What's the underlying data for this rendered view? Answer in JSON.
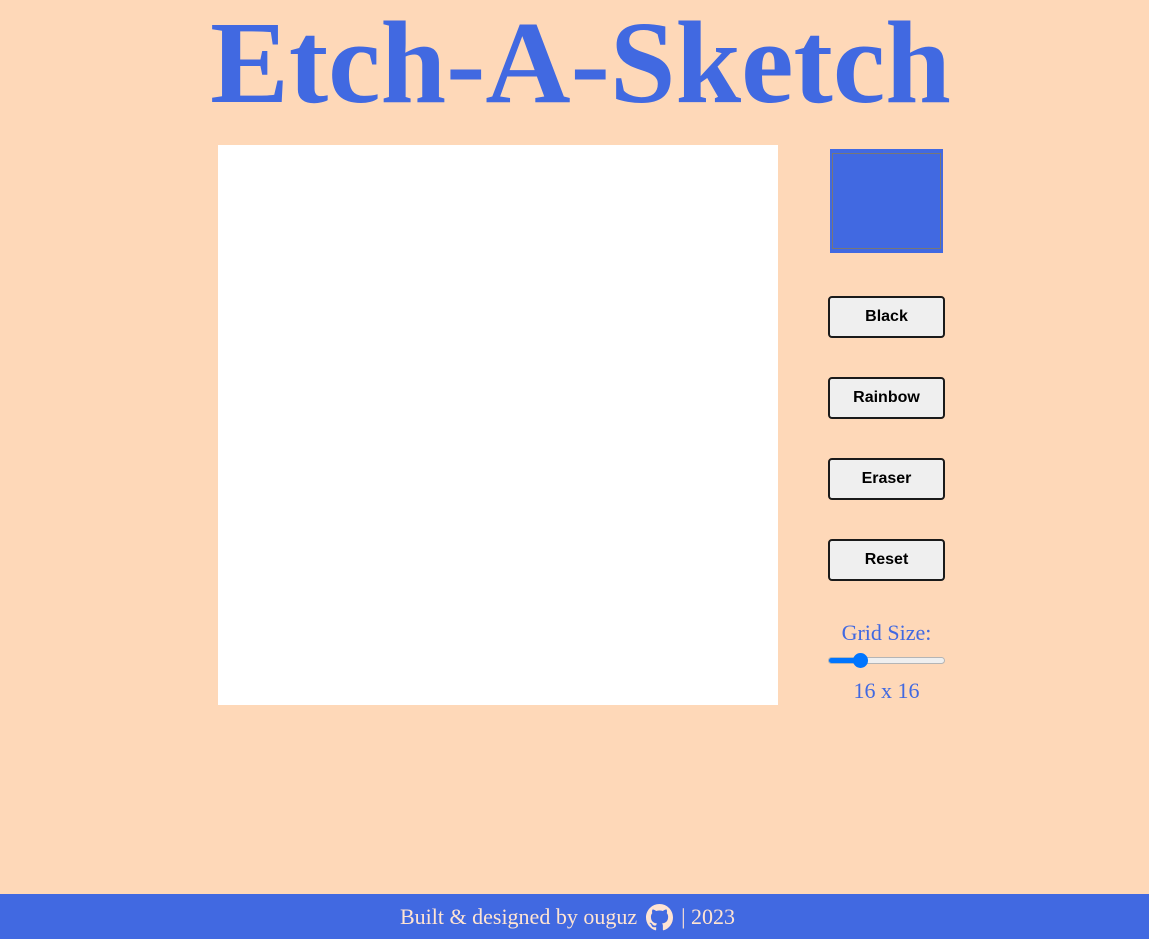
{
  "page": {
    "title": "Etch-A-Sketch"
  },
  "palette": {
    "background": "#fed8b8",
    "accent": "#4169e1",
    "canvas": "#ffffff",
    "footer_text": "#ffe4d2"
  },
  "controls": {
    "current_color": "#4169e1",
    "black_label": "Black",
    "rainbow_label": "Rainbow",
    "eraser_label": "Eraser",
    "reset_label": "Reset",
    "grid_size_label": "Grid Size:",
    "grid_size_value": 16,
    "grid_size_min": 1,
    "grid_size_max": 64,
    "grid_size_display": "16 x 16"
  },
  "footer": {
    "credit": "Built & designed by ouguz",
    "icon": "github-icon",
    "year_text": "| 2023"
  }
}
